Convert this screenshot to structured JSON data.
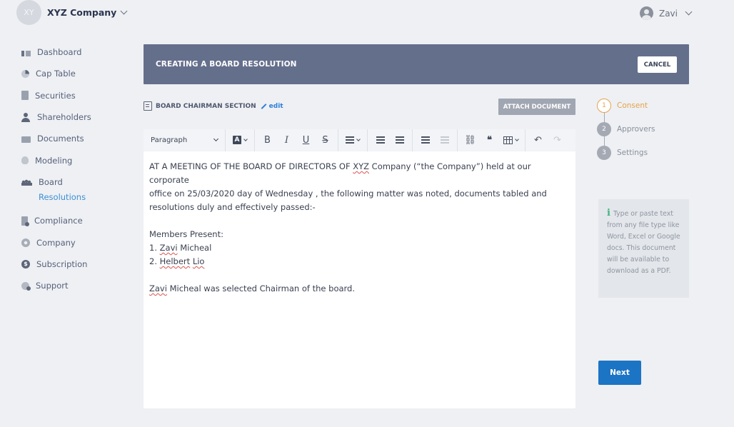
{
  "header": {
    "avatar_initials": "XY",
    "company_name": "XYZ Company",
    "user_name": "Zavi"
  },
  "sidebar": {
    "items": [
      {
        "label": "Dashboard",
        "icon": "dashboard-icon"
      },
      {
        "label": "Cap Table",
        "icon": "pie-chart-icon"
      },
      {
        "label": "Securities",
        "icon": "clipboard-icon"
      },
      {
        "label": "Shareholders",
        "icon": "person-icon"
      },
      {
        "label": "Documents",
        "icon": "folder-icon"
      },
      {
        "label": "Modeling",
        "icon": "lightbulb-icon"
      },
      {
        "label": "Board",
        "icon": "board-icon"
      },
      {
        "label": "Compliance",
        "icon": "document-badge-icon"
      },
      {
        "label": "Company",
        "icon": "gear-icon"
      },
      {
        "label": "Subscription",
        "icon": "dollar-icon"
      },
      {
        "label": "Support",
        "icon": "support-icon"
      }
    ],
    "board_sub": "Resolutions"
  },
  "banner": {
    "title": "CREATING A BOARD RESOLUTION",
    "cancel_label": "CANCEL"
  },
  "section": {
    "title": "BOARD CHAIRMAN SECTION",
    "edit_label": "edit",
    "attach_label": "ATTACH DOCUMENT"
  },
  "editor": {
    "paragraph_style": "Paragraph",
    "content": {
      "line1": "AT A MEETING OF THE BOARD OF DIRECTORS OF ",
      "line1_xyz": "XYZ",
      "line1_rest": " Company (“the Company”) held at our corporate",
      "line2": "office on  25/03/2020 day of Wednesday , the following matter was noted, documents tabled and",
      "line3": "resolutions duly and effectively passed:-",
      "members_heading": "Members Present:",
      "m1_num": "1. ",
      "m1_first": "Zavi",
      "m1_last": " Micheal",
      "m2_num": "2. ",
      "m2_first": "Helbert",
      "m2_mid": " ",
      "m2_last": "Lio",
      "closing_first": "Zavi",
      "closing_rest": " Micheal was selected Chairman of the board."
    }
  },
  "steps": [
    {
      "num": "1",
      "label": "Consent",
      "state": "active"
    },
    {
      "num": "2",
      "label": "Approvers",
      "state": "idle"
    },
    {
      "num": "3",
      "label": "Settings",
      "state": "idle"
    }
  ],
  "info": {
    "icon": "i",
    "text": "Type or paste text from any file type like Word, Excel or Google docs. This document will be available to download as a PDF."
  },
  "next_label": "Next",
  "colors": {
    "banner": "#646f8c",
    "accent_orange": "#e6a24b",
    "primary_blue": "#1c74c4",
    "link_blue": "#2f7ed8"
  }
}
